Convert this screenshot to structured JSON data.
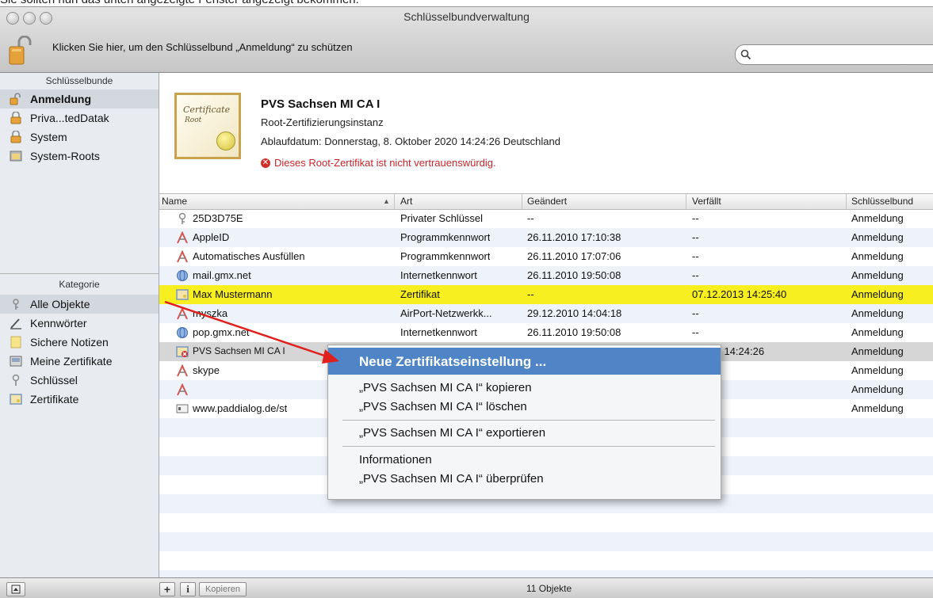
{
  "caption": "Sie sollten nun das unten angezeigte Fenster angezeigt bekommen:",
  "window": {
    "title": "Schlüsselbundverwaltung",
    "lock_message": "Klicken Sie hier, um den Schlüsselbund „Anmeldung“ zu schützen",
    "search_placeholder": ""
  },
  "sidebar": {
    "keychains_header": "Schlüsselbunde",
    "keychains": [
      {
        "label": "Anmeldung",
        "icon": "unlocked-keychain-icon",
        "selected": true
      },
      {
        "label": "Priva...tedDatak",
        "icon": "locked-keychain-icon"
      },
      {
        "label": "System",
        "icon": "locked-keychain-icon"
      },
      {
        "label": "System-Roots",
        "icon": "folder-icon"
      }
    ],
    "category_header": "Kategorie",
    "categories": [
      {
        "label": "Alle Objekte",
        "icon": "all-items-icon",
        "selected": true
      },
      {
        "label": "Kennwörter",
        "icon": "passwords-icon"
      },
      {
        "label": "Sichere Notizen",
        "icon": "secure-notes-icon"
      },
      {
        "label": "Meine Zertifikate",
        "icon": "my-certificates-icon"
      },
      {
        "label": "Schlüssel",
        "icon": "key-icon"
      },
      {
        "label": "Zertifikate",
        "icon": "certificate-icon"
      }
    ]
  },
  "info": {
    "cert_script": "Certificate",
    "cert_sub": "Root",
    "title": "PVS Sachsen MI CA I",
    "subtitle": "Root-Zertifizierungsinstanz",
    "expiry": "Ablaufdatum: Donnerstag, 8. Oktober 2020 14:24:26 Deutschland",
    "warning": "Dieses Root-Zertifikat ist nicht vertrauenswürdig."
  },
  "table": {
    "columns": [
      "Name",
      "Art",
      "Geändert",
      "Verfällt",
      "Schlüsselbund"
    ],
    "sort_indicator": "▲",
    "rows": [
      {
        "name": "25D3D75E",
        "icon": "key-icon",
        "art": "Privater Schlüssel",
        "geaendert": "--",
        "verfaellt": "--",
        "bund": "Anmeldung"
      },
      {
        "name": "AppleID",
        "icon": "password-app-icon",
        "art": "Programmkennwort",
        "geaendert": "26.11.2010 17:10:38",
        "verfaellt": "--",
        "bund": "Anmeldung"
      },
      {
        "name": "Automatisches Ausfüllen",
        "icon": "password-app-icon",
        "art": "Programmkennwort",
        "geaendert": "26.11.2010 17:07:06",
        "verfaellt": "--",
        "bund": "Anmeldung"
      },
      {
        "name": "mail.gmx.net",
        "icon": "globe-icon",
        "art": "Internetkennwort",
        "geaendert": "26.11.2010 19:50:08",
        "verfaellt": "--",
        "bund": "Anmeldung"
      },
      {
        "name": "Max Mustermann",
        "icon": "certificate-icon",
        "art": "Zertifikat",
        "geaendert": "--",
        "verfaellt": "07.12.2013 14:25:40",
        "bund": "Anmeldung",
        "highlight": true
      },
      {
        "name": "myszka",
        "icon": "password-app-icon",
        "art": "AirPort-Netzwerkk...",
        "geaendert": "29.12.2010 14:04:18",
        "verfaellt": "--",
        "bund": "Anmeldung"
      },
      {
        "name": "pop.gmx.net",
        "icon": "globe-icon",
        "art": "Internetkennwort",
        "geaendert": "26.11.2010 19:50:08",
        "verfaellt": "--",
        "bund": "Anmeldung"
      },
      {
        "name": "PVS Sachsen MI CA I",
        "icon": "untrusted-certificate-icon",
        "art": "",
        "geaendert": "",
        "verfaellt": ").2020 14:24:26",
        "bund": "Anmeldung",
        "selected": true
      },
      {
        "name": "skype",
        "icon": "password-app-icon",
        "art": "",
        "geaendert": "",
        "verfaellt": "",
        "bund": "Anmeldung"
      },
      {
        "name": "",
        "icon": "password-app-icon",
        "art": "",
        "geaendert": "",
        "verfaellt": "",
        "bund": "Anmeldung"
      },
      {
        "name": "www.paddialog.de/st",
        "icon": "web-form-icon",
        "art": "",
        "geaendert": "",
        "verfaellt": "",
        "bund": "Anmeldung"
      }
    ]
  },
  "context_menu": {
    "items": [
      {
        "label": "Neue Zertifikatseinstellung ...",
        "active": true
      },
      {
        "label": "„PVS Sachsen MI CA I“ kopieren"
      },
      {
        "label": "„PVS Sachsen MI CA I“ löschen"
      },
      {
        "label": "„PVS Sachsen MI CA I“ exportieren"
      },
      {
        "label": "Informationen"
      },
      {
        "label": "„PVS Sachsen MI CA I“ überprüfen"
      }
    ]
  },
  "bottom": {
    "add_label": "+",
    "info_label": "i",
    "copy_label": "Kopieren",
    "count": "11 Objekte"
  },
  "colors": {
    "highlight_row": "#f7ef1f",
    "menu_active": "#4f85c6",
    "warning": "#c8262a",
    "arrow": "#e0201c"
  }
}
